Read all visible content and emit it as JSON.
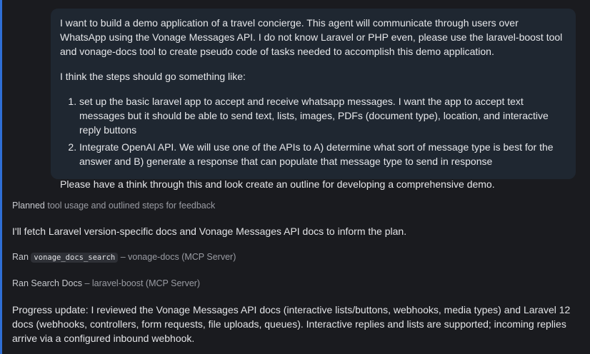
{
  "user_message": {
    "intro": "I want to build a demo application of a travel concierge. This agent will communicate through users over WhatsApp using the Vonage Messages API. I do not know Laravel or PHP even, please use the laravel-boost tool and vonage-docs tool to create pseudo code of tasks needed to accomplish this demo application.",
    "steps_intro": "I think the steps should go something like:",
    "steps": [
      "set up the basic laravel app to accept and receive whatsapp messages. I want the app to accept text messages but it should be able to send text, lists, images, PDFs (document type), location, and interactive reply buttons",
      "Integrate OpenAI API. We will use one of the APIs to A) determine what sort of message type is best for the answer and B) generate a response that can populate that message type to send in response"
    ],
    "closing": "Please have a think through this and look create an outline for developing a comprehensive demo."
  },
  "thinking": {
    "label": "Planned",
    "text": "tool usage and outlined steps for feedback"
  },
  "assistant_text": "I'll fetch Laravel version-specific docs and Vonage Messages API docs to inform the plan.",
  "tool_calls": [
    {
      "verb": "Ran",
      "name": "vonage_docs_search",
      "separator": "–",
      "server": "vonage-docs (MCP Server)"
    },
    {
      "verb": "Ran Search Docs",
      "separator": "–",
      "server": "laravel-boost (MCP Server)"
    }
  ],
  "progress_update": "Progress update: I reviewed the Vonage Messages API docs (interactive lists/buttons, webhooks, media types) and Laravel 12 docs (webhooks, controllers, form requests, file uploads, queues). Interactive replies and lists are supported; incoming replies arrive via a configured inbound webhook.",
  "colors": {
    "background": "#1a1b1f",
    "bubble": "#1f2731",
    "accent_rail": "#2f6fd6",
    "muted_text": "#9a9ca3"
  }
}
